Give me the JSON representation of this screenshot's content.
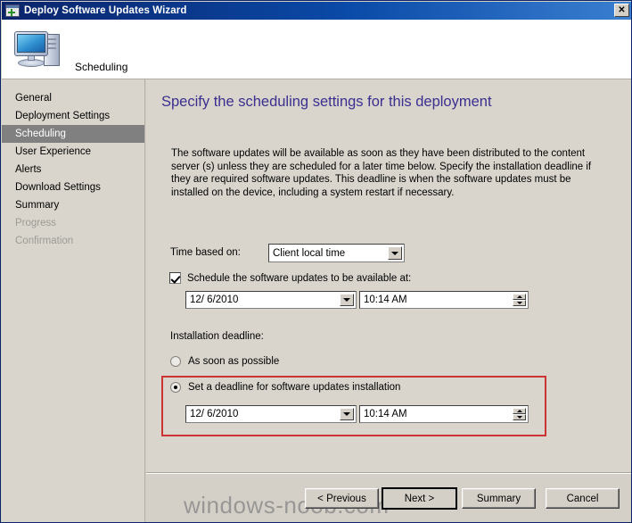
{
  "window": {
    "title": "Deploy Software Updates Wizard",
    "title_icon": "wizard-window-icon",
    "close_label": "✕",
    "accent_titlebar": "#0a246a",
    "background": "#d4d0c8"
  },
  "header": {
    "icon": "computer-monitor-icon",
    "title": "Scheduling"
  },
  "sidebar": {
    "items": [
      {
        "label": "General",
        "state": "normal"
      },
      {
        "label": "Deployment Settings",
        "state": "normal"
      },
      {
        "label": "Scheduling",
        "state": "selected"
      },
      {
        "label": "User Experience",
        "state": "normal"
      },
      {
        "label": "Alerts",
        "state": "normal"
      },
      {
        "label": "Download Settings",
        "state": "normal"
      },
      {
        "label": "Summary",
        "state": "normal"
      },
      {
        "label": "Progress",
        "state": "disabled"
      },
      {
        "label": "Confirmation",
        "state": "disabled"
      }
    ],
    "selected_background": "#808080"
  },
  "main": {
    "heading": "Specify the scheduling settings for this deployment",
    "heading_color": "#3b2f8f",
    "intro": "The software updates will be available as soon as they have been distributed to the content server (s) unless they are scheduled for a later time below. Specify the installation deadline if they are required software updates. This deadline is when the software updates must be installed on the device, including a system restart if necessary.",
    "time_based_on": {
      "label": "Time based on:",
      "value": "Client local time",
      "arrow_icon": "chevron-down-icon"
    },
    "schedule_available": {
      "label": "Schedule the software updates to be available at:",
      "checked": true,
      "date_value": "12/  6/2010",
      "date_arrow_icon": "chevron-down-icon",
      "time_value": "10:14 AM",
      "spinner_icon": "spinner-up-down-icon"
    },
    "installation_deadline": {
      "label": "Installation deadline:",
      "options": [
        {
          "label": "As soon as possible",
          "selected": false
        },
        {
          "label": "Set a deadline for software updates installation",
          "selected": true
        }
      ],
      "date_value": "12/  6/2010",
      "date_arrow_icon": "chevron-down-icon",
      "time_value": "10:14 AM",
      "spinner_icon": "spinner-up-down-icon",
      "highlight_color": "#cc3333"
    }
  },
  "footer": {
    "previous_label": "< Previous",
    "next_label": "Next >",
    "summary_label": "Summary",
    "cancel_label": "Cancel"
  },
  "watermark": {
    "text": "windows-noob.com"
  }
}
